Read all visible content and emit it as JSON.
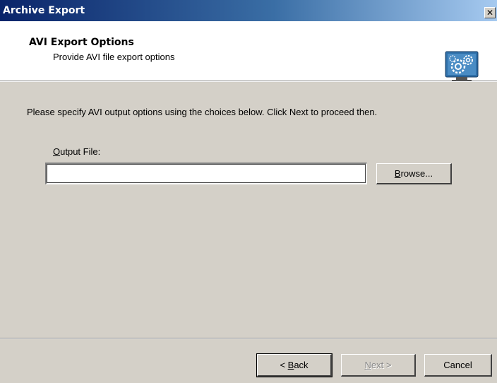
{
  "window": {
    "title": "Archive Export",
    "close_glyph": "✕"
  },
  "header": {
    "heading": "AVI Export Options",
    "subheading": "Provide AVI file export options",
    "icon": "gears-monitor-icon"
  },
  "main": {
    "instructions": "Please specify AVI output options using the choices below. Click Next to proceed then.",
    "output_label_accel": "O",
    "output_label_rest": "utput File:",
    "output_value": "",
    "browse_accel": "B",
    "browse_rest": "rowse..."
  },
  "footer": {
    "back_prefix": "< ",
    "back_accel": "B",
    "back_rest": "ack",
    "next_accel": "N",
    "next_rest": "ext >",
    "cancel_label": "Cancel"
  },
  "colors": {
    "dialog_bg": "#d4d0c8",
    "titlebar_start": "#0a246a",
    "titlebar_end": "#a6caf0",
    "icon_bg": "#2f6fa8"
  }
}
